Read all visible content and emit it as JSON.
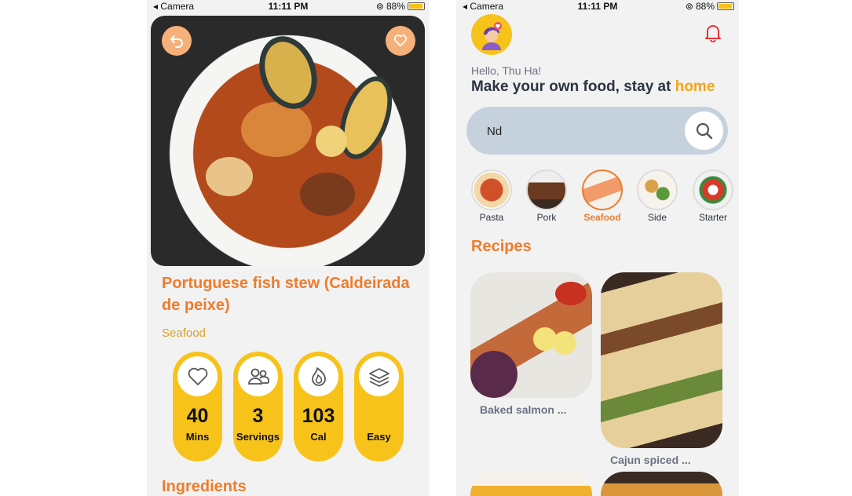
{
  "status_bar": {
    "carrier": "◂ Camera",
    "time": "11:11 PM",
    "battery": "88%"
  },
  "detail": {
    "title": "Portuguese fish stew (Caldeirada de peixe)",
    "category": "Seafood",
    "stats": [
      {
        "value": "40",
        "unit": "Mins",
        "icon": "heart-icon"
      },
      {
        "value": "3",
        "unit": "Servings",
        "icon": "people-icon"
      },
      {
        "value": "103",
        "unit": "Cal",
        "icon": "flame-icon"
      },
      {
        "value": "",
        "unit": "Easy",
        "icon": "layers-icon"
      }
    ],
    "ingredients_heading": "Ingredients"
  },
  "home": {
    "greeting": "Hello, Thu Ha!",
    "headline_main": "Make your own food, stay at ",
    "headline_accent": "home",
    "search_value": "Nd",
    "categories": [
      {
        "label": "Pasta"
      },
      {
        "label": "Pork"
      },
      {
        "label": "Seafood",
        "active": true
      },
      {
        "label": "Side"
      },
      {
        "label": "Starter"
      }
    ],
    "recipes_heading": "Recipes",
    "recipes": [
      {
        "name": "Baked salmon  ..."
      },
      {
        "name": "Cajun spiced  ..."
      }
    ]
  },
  "colors": {
    "accent": "#f07b2b",
    "yellow": "#f7c31a",
    "search_bg": "#c6d1de"
  }
}
